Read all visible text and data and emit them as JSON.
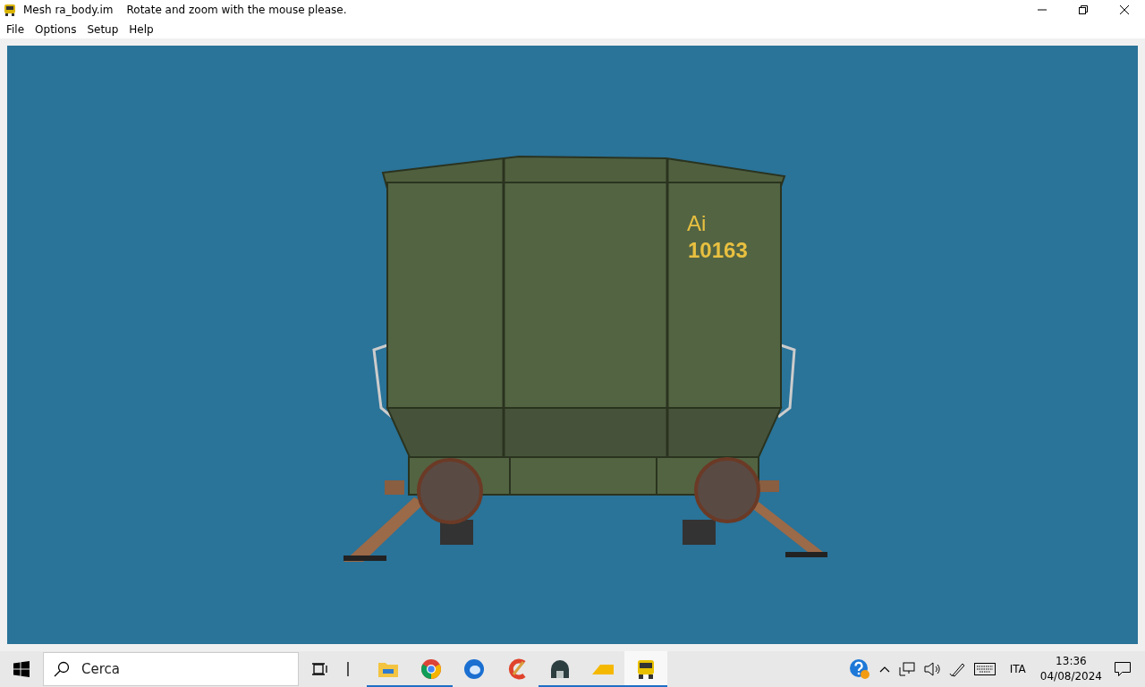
{
  "window": {
    "title": "Mesh ra_body.im",
    "message": "Rotate and zoom with the mouse please."
  },
  "menu": [
    "File",
    "Options",
    "Setup",
    "Help"
  ],
  "viewport": {
    "model_labels": [
      "Ai",
      "10163"
    ]
  },
  "taskbar": {
    "search": {
      "placeholder": "Cerca"
    },
    "apps": [
      {
        "kind": "folder",
        "running": true,
        "selected": false
      },
      {
        "kind": "browser",
        "running": true,
        "selected": false
      },
      {
        "kind": "mail",
        "running": false,
        "selected": false
      },
      {
        "kind": "brush",
        "running": false,
        "selected": false
      },
      {
        "kind": "station",
        "running": true,
        "selected": false
      },
      {
        "kind": "wedge",
        "running": true,
        "selected": false
      },
      {
        "kind": "train",
        "running": true,
        "selected": true
      }
    ],
    "language": "ITA",
    "time": "13:36",
    "date": "04/08/2024"
  }
}
